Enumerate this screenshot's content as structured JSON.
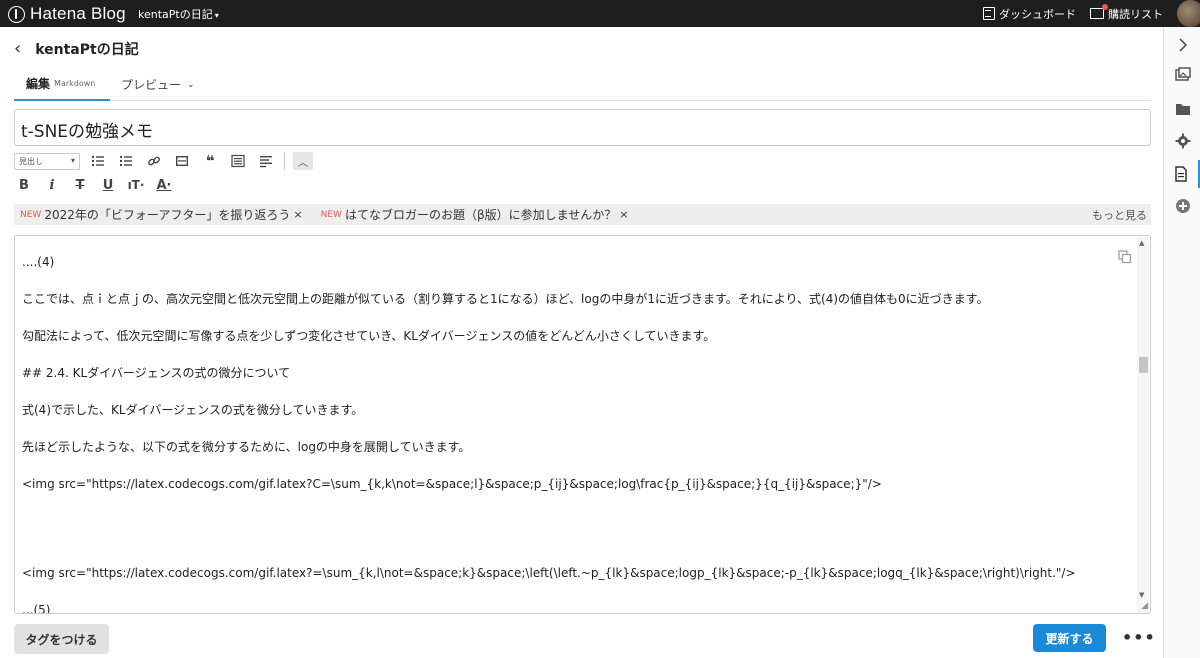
{
  "topbar": {
    "logo_text": "Hatena Blog",
    "blog_switch_label": "kentaPtの日記",
    "dashboard_label": "ダッシュボード",
    "reading_list_label": "購読リスト"
  },
  "header": {
    "blog_title": "kentaPtの日記"
  },
  "tabs": {
    "edit_label": "編集",
    "edit_mode": "Markdown",
    "preview_label": "プレビュー"
  },
  "article": {
    "title": "t-SNEの勉強メモ"
  },
  "toolbar": {
    "heading_select_value": "見出し"
  },
  "notices": {
    "items": [
      {
        "badge": "NEW",
        "text": "2022年の「ビフォーアフター」を振り返ろう"
      },
      {
        "badge": "NEW",
        "text": "はてなブロガーのお題（β版）に参加しませんか？"
      }
    ],
    "more_label": "もっと見る",
    "close_glyph": "×"
  },
  "editor": {
    "lines": [
      "....(4)",
      "ここでは、点ｉと点ｊの、高次元空間と低次元空間上の距離が似ている（割り算すると1になる）ほど、logの中身が1に近づきます。それにより、式(4)の値自体も0に近づきます。",
      "勾配法によって、低次元空間に写像する点を少しずつ変化させていき、KLダイバージェンスの値をどんどん小さくしていきます。",
      "## 2.4. KLダイバージェンスの式の微分について",
      "式(4)で示した、KLダイバージェンスの式を微分していきます。",
      "先ほど示したような、以下の式を微分するために、logの中身を展開していきます。",
      "<img src=\"https://latex.codecogs.com/gif.latex?C=\\sum_{k,k\\not=&space;l}&space;p_{ij}&space;log\\frac{p_{ij}&space;}{q_{ij}&space;}\"/>",
      "",
      "<img src=\"https://latex.codecogs.com/gif.latex?=\\sum_{k,l\\not=&space;k}&space;\\left(\\left.~p_{lk}&space;logp_{lk}&space;-p_{lk}&space;logq_{lk}&space;\\right)\\right.\"/>",
      "...(5)"
    ]
  },
  "footer": {
    "tag_button_label": "タグをつける",
    "update_button_label": "更新する",
    "more_label": "•••"
  },
  "colors": {
    "accent": "#2a8fd8",
    "update_button": "#1b8ad6",
    "topbar": "#1e1e1e",
    "new_badge": "#e0604c"
  }
}
